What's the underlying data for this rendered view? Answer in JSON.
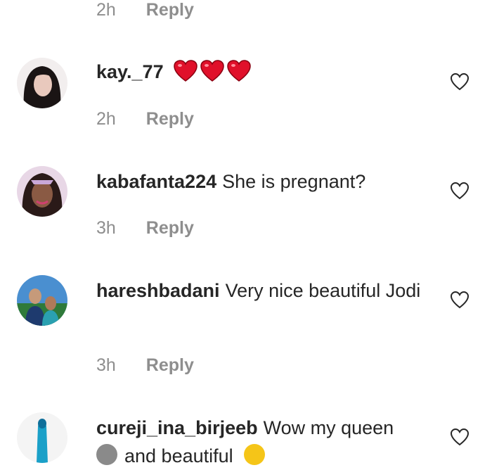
{
  "top_meta": {
    "time": "2h",
    "reply": "Reply"
  },
  "comments": [
    {
      "username": "kay._77",
      "text": "",
      "emoji": "❤❤❤",
      "time": "2h",
      "reply": "Reply"
    },
    {
      "username": "kabafanta224",
      "text": "She is pregnant?",
      "time": "3h",
      "reply": "Reply"
    },
    {
      "username": "hareshbadani",
      "text": "Very nice beautiful Jodi",
      "time": "3h",
      "reply": "Reply"
    },
    {
      "username": "cureji_ina_birjeeb",
      "text": "Wow my queen",
      "text_2": "and beautiful"
    }
  ],
  "colors": {
    "text": "#262626",
    "muted": "#8e8e8e",
    "heart_emoji": "#e0102a"
  }
}
